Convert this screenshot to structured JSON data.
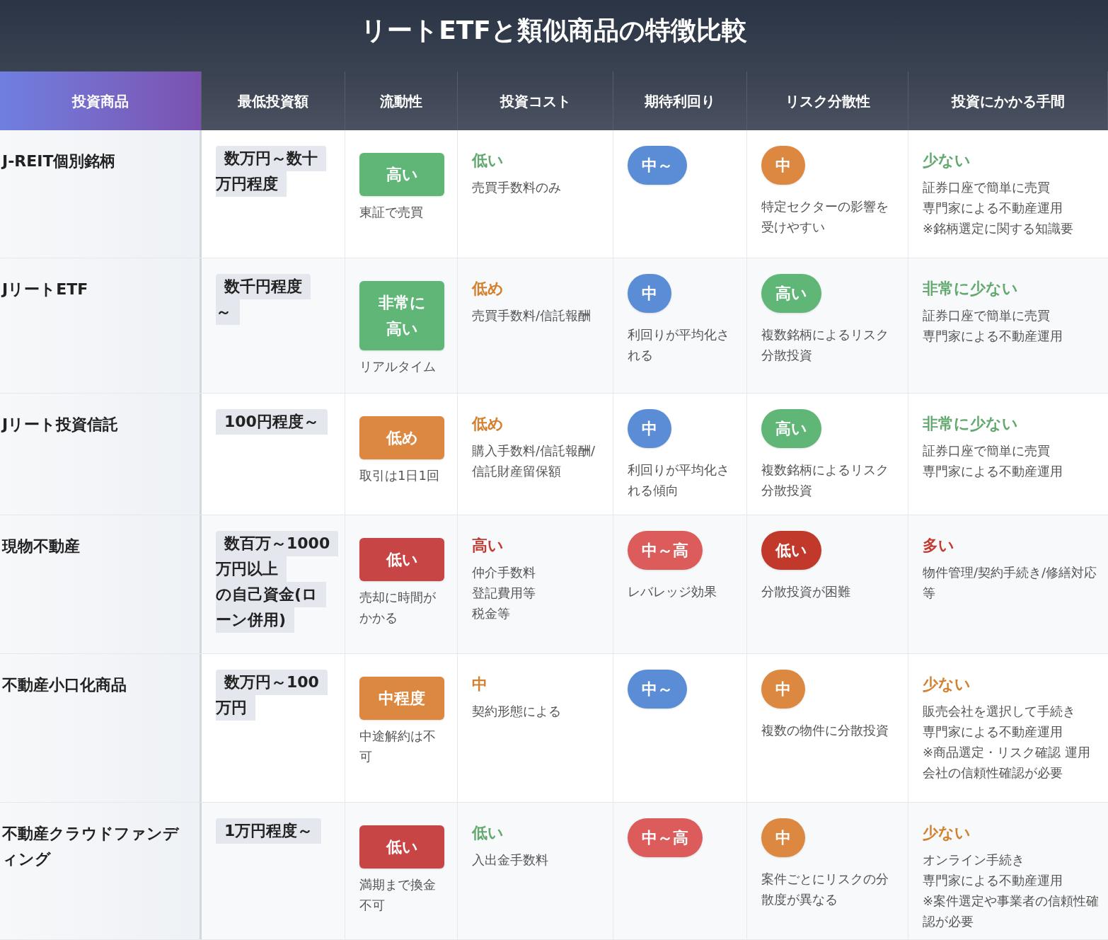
{
  "title": "リートETFと類似商品の特徴比較",
  "columns": [
    "投資商品",
    "最低投資額",
    "流動性",
    "投資コスト",
    "期待利回り",
    "リスク分散性",
    "投資にかかる手間"
  ],
  "rows": [
    {
      "name": "J-REIT個別銘柄",
      "min_investment": [
        "数万円～数十",
        "万円程度"
      ],
      "liquidity": {
        "label": "高い",
        "color": "#5fb676",
        "note": "東証で売買"
      },
      "cost": {
        "label": "低い",
        "color": "#62a86f",
        "note": "売買手数料のみ"
      },
      "return": {
        "label": "中～",
        "color": "#5b8dd6"
      },
      "risk": {
        "label": "中",
        "color": "#dc8840",
        "note": "特定セクターの影響を受けやすい"
      },
      "effort": {
        "label": "少ない",
        "color": "#62a86f",
        "notes": [
          "証券口座で簡単に売買",
          "専門家による不動産運用",
          "※銘柄選定に関する知識要"
        ]
      }
    },
    {
      "name": "JリートETF",
      "min_investment": [
        "数千円程度",
        "～"
      ],
      "liquidity": {
        "label": "非常に高い",
        "color": "#5fb676",
        "note": "リアルタイム"
      },
      "cost": {
        "label": "低め",
        "color": "#d4812f",
        "note": "売買手数料/信託報酬"
      },
      "return": {
        "label": "中",
        "color": "#5b8dd6",
        "note": "利回りが平均化される"
      },
      "risk": {
        "label": "高い",
        "color": "#5fb676",
        "note": "複数銘柄によるリスク分散投資"
      },
      "effort": {
        "label": "非常に少ない",
        "color": "#62a86f",
        "notes": [
          "証券口座で簡単に売買",
          "専門家による不動産運用"
        ]
      }
    },
    {
      "name": "Jリート投資信託",
      "min_investment": [
        "100円程度～"
      ],
      "liquidity": {
        "label": "低め",
        "color": "#dc8840",
        "note": "取引は1日1回"
      },
      "cost": {
        "label": "低め",
        "color": "#d4812f",
        "note": "購入手数料/信託報酬/信託財産留保額"
      },
      "return": {
        "label": "中",
        "color": "#5b8dd6",
        "note": "利回りが平均化される傾向"
      },
      "risk": {
        "label": "高い",
        "color": "#5fb676",
        "note": "複数銘柄によるリスク分散投資"
      },
      "effort": {
        "label": "非常に少ない",
        "color": "#62a86f",
        "notes": [
          "証券口座で簡単に売買",
          "専門家による不動産運用"
        ]
      }
    },
    {
      "name": "現物不動産",
      "min_investment": [
        "数百万～1000",
        "万円以上",
        "の自己資金(ロ",
        "ーン併用)"
      ],
      "liquidity": {
        "label": "低い",
        "color": "#c84545",
        "note": "売却に時間がかかる"
      },
      "cost": {
        "label": "高い",
        "color": "#c23b32",
        "note": [
          "仲介手数料",
          "登記費用等",
          "税金等"
        ]
      },
      "return": {
        "label": "中～高",
        "color": "#dc5c5c",
        "note": "レバレッジ効果"
      },
      "risk": {
        "label": "低い",
        "color": "#c0392b",
        "note": "分散投資が困難"
      },
      "effort": {
        "label": "多い",
        "color": "#c23b32",
        "notes": [
          "物件管理/契約手続き/修繕対応等"
        ]
      }
    },
    {
      "name": "不動産小口化商品",
      "min_investment": [
        "数万円～100",
        "万円"
      ],
      "liquidity": {
        "label": "中程度",
        "color": "#dc8840",
        "note": "中途解約は不可"
      },
      "cost": {
        "label": "中",
        "color": "#d4812f",
        "note": "契約形態による"
      },
      "return": {
        "label": "中～",
        "color": "#5b8dd6"
      },
      "risk": {
        "label": "中",
        "color": "#dc8840",
        "note": "複数の物件に分散投資"
      },
      "effort": {
        "label": "少ない",
        "color": "#d4812f",
        "notes": [
          "販売会社を選択して手続き",
          "専門家による不動産運用",
          "※商品選定・リスク確認 運用会社の信頼性確認が必要"
        ]
      }
    },
    {
      "name": "不動産クラウドファンディング",
      "min_investment": [
        "1万円程度～"
      ],
      "liquidity": {
        "label": "低い",
        "color": "#c84545",
        "note": "満期まで換金不可"
      },
      "cost": {
        "label": "低い",
        "color": "#62a86f",
        "note": "入出金手数料"
      },
      "return": {
        "label": "中～高",
        "color": "#dc5c5c"
      },
      "risk": {
        "label": "中",
        "color": "#dc8840",
        "note": "案件ごとにリスクの分散度が異なる"
      },
      "effort": {
        "label": "少ない",
        "color": "#d4812f",
        "notes": [
          "オンライン手続き",
          "専門家による不動産運用",
          "※案件選定や事業者の信頼性確認が必要"
        ]
      }
    }
  ]
}
